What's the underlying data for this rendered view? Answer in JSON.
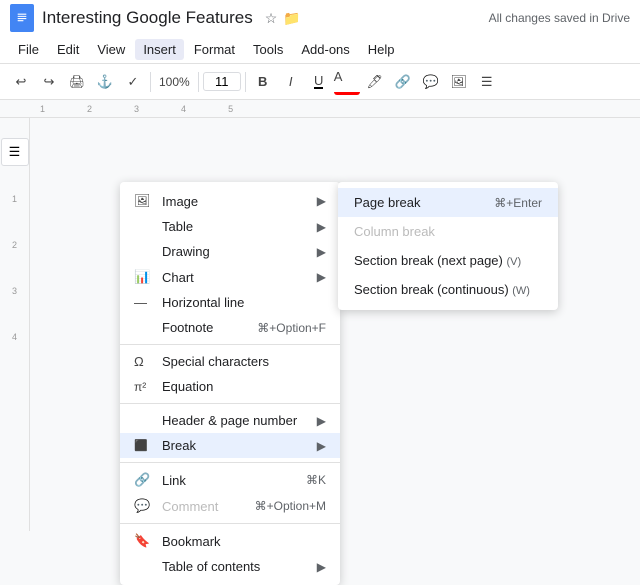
{
  "titleBar": {
    "title": "Interesting Google Features",
    "savedText": "All changes saved in Drive"
  },
  "menuBar": {
    "items": [
      "File",
      "Edit",
      "View",
      "Insert",
      "Format",
      "Tools",
      "Add-ons",
      "Help"
    ]
  },
  "toolbar": {
    "fontSize": "11"
  },
  "insertMenu": {
    "items": [
      {
        "id": "image",
        "icon": "🖼",
        "label": "Image",
        "hasArrow": true,
        "shortcut": ""
      },
      {
        "id": "table",
        "icon": "",
        "label": "Table",
        "hasArrow": true,
        "shortcut": ""
      },
      {
        "id": "drawing",
        "icon": "",
        "label": "Drawing",
        "hasArrow": true,
        "shortcut": ""
      },
      {
        "id": "chart",
        "icon": "📊",
        "label": "Chart",
        "hasArrow": true,
        "shortcut": ""
      },
      {
        "id": "hline",
        "icon": "—",
        "label": "Horizontal line",
        "hasArrow": false,
        "shortcut": ""
      },
      {
        "id": "footnote",
        "icon": "",
        "label": "Footnote",
        "hasArrow": false,
        "shortcut": "⌘+Option+F"
      },
      {
        "id": "special-chars",
        "icon": "Ω",
        "label": "Special characters",
        "hasArrow": false,
        "shortcut": ""
      },
      {
        "id": "equation",
        "icon": "π",
        "label": "Equation",
        "hasArrow": false,
        "shortcut": ""
      },
      {
        "id": "header",
        "icon": "",
        "label": "Header & page number",
        "hasArrow": true,
        "shortcut": ""
      },
      {
        "id": "break",
        "icon": "⬛",
        "label": "Break",
        "hasArrow": true,
        "shortcut": "",
        "active": true
      },
      {
        "id": "link",
        "icon": "🔗",
        "label": "Link",
        "hasArrow": false,
        "shortcut": "⌘K"
      },
      {
        "id": "comment",
        "icon": "💬",
        "label": "Comment",
        "hasArrow": false,
        "shortcut": "⌘+Option+M",
        "disabled": true
      },
      {
        "id": "bookmark",
        "icon": "🔖",
        "label": "Bookmark",
        "hasArrow": false,
        "shortcut": ""
      },
      {
        "id": "toc",
        "icon": "",
        "label": "Table of contents",
        "hasArrow": true,
        "shortcut": ""
      }
    ]
  },
  "breakSubmenu": {
    "items": [
      {
        "id": "page-break",
        "label": "Page break",
        "shortcut": "⌘+Enter",
        "active": true,
        "disabled": false
      },
      {
        "id": "column-break",
        "label": "Column break",
        "shortcut": "",
        "active": false,
        "disabled": true
      },
      {
        "id": "section-next",
        "label": "Section break (next page)",
        "note": "(V)",
        "active": false,
        "disabled": false
      },
      {
        "id": "section-cont",
        "label": "Section break (continuous)",
        "note": "(W)",
        "active": false,
        "disabled": false
      }
    ]
  },
  "ruler": {
    "marks": [
      "1",
      "2",
      "3",
      "4",
      "5"
    ]
  },
  "sideRuler": {
    "marks": [
      "1",
      "2",
      "3",
      "4"
    ]
  }
}
